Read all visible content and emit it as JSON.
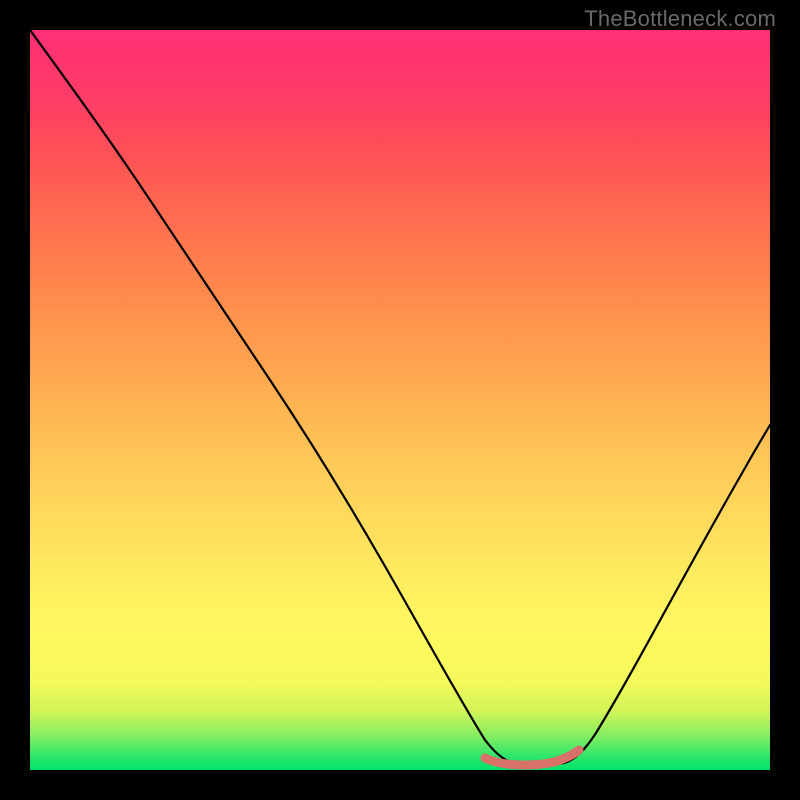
{
  "watermark": "TheBottleneck.com",
  "chart_data": {
    "type": "line",
    "title": "",
    "xlabel": "",
    "ylabel": "",
    "xlim": [
      0,
      100
    ],
    "ylim": [
      0,
      100
    ],
    "grid": false,
    "series": [
      {
        "name": "curve",
        "x": [
          0,
          5,
          10,
          15,
          20,
          25,
          30,
          35,
          40,
          45,
          50,
          55,
          60,
          63,
          68,
          72,
          75,
          80,
          85,
          90,
          95,
          100
        ],
        "y": [
          100,
          92,
          84,
          76,
          68,
          60,
          52,
          44,
          36,
          28,
          20,
          12,
          5,
          2,
          1,
          1,
          2,
          8,
          18,
          30,
          44,
          60
        ]
      },
      {
        "name": "optimal-range",
        "x": [
          62,
          64,
          66,
          68,
          70,
          72,
          74
        ],
        "y": [
          1.2,
          0.8,
          0.6,
          0.6,
          0.6,
          0.8,
          1.2
        ]
      }
    ],
    "colors": {
      "curve": "#000000",
      "optimal-range": "#d87168",
      "gradient_top": "#ff2f76",
      "gradient_mid": "#ffe85f",
      "gradient_bottom": "#00e36b"
    }
  }
}
